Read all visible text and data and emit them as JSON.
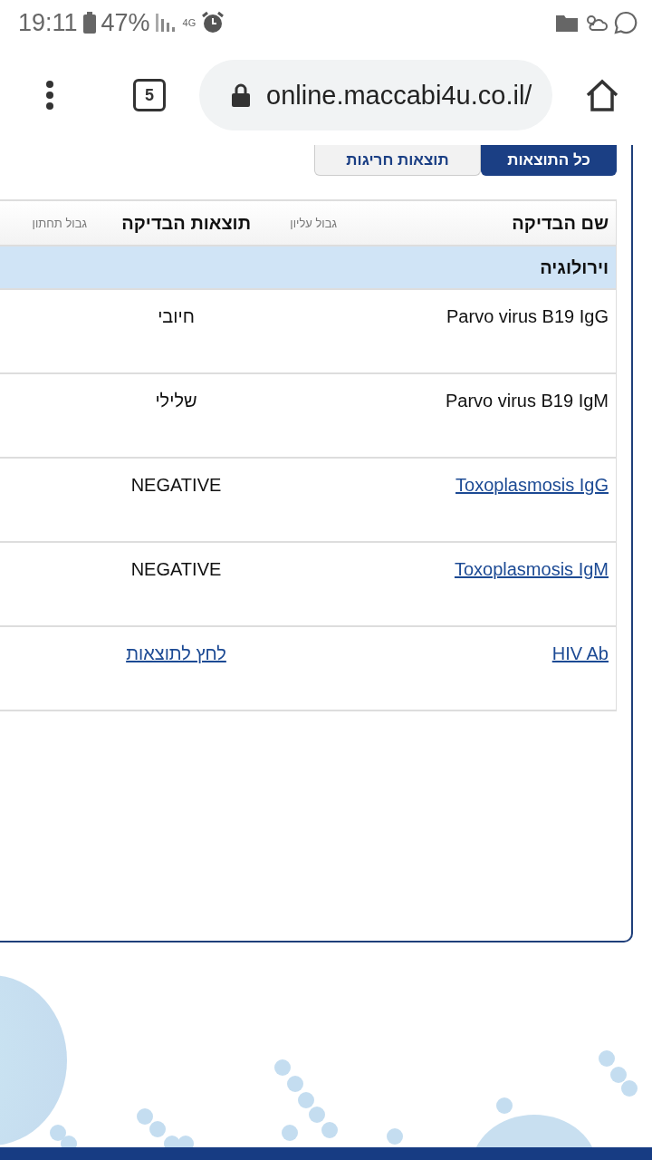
{
  "status_bar": {
    "time": "19:11",
    "battery": "47%",
    "network": "4G"
  },
  "browser": {
    "tab_count": "5",
    "url": "online.maccabi4u.co.il/"
  },
  "tabs": [
    {
      "label": "כל התוצאות",
      "selected": true
    },
    {
      "label": "תוצאות חריגות",
      "selected": false
    }
  ],
  "table": {
    "columns": [
      {
        "label": "שם הבדיקה",
        "kind": "main"
      },
      {
        "label": "גבול עליון",
        "kind": "minor"
      },
      {
        "label": "תוצאות הבדיקה",
        "kind": "main"
      },
      {
        "label": "גבול תחתון",
        "kind": "minor"
      }
    ],
    "group": "וירולוגיה",
    "rows": [
      {
        "name": {
          "text": "Parvo virus B19 IgG",
          "kind": "plain"
        },
        "result": {
          "text": "חיובי",
          "kind": "plain"
        }
      },
      {
        "name": {
          "text": "Parvo virus B19 IgM",
          "kind": "plain"
        },
        "result": {
          "text": "שלילי",
          "kind": "plain"
        }
      },
      {
        "name": {
          "text": "Toxoplasmosis IgG",
          "kind": "link"
        },
        "result": {
          "text": "NEGATIVE",
          "kind": "plain"
        }
      },
      {
        "name": {
          "text": "Toxoplasmosis IgM",
          "kind": "link"
        },
        "result": {
          "text": "NEGATIVE",
          "kind": "plain"
        }
      },
      {
        "name": {
          "text": "HIV Ab",
          "kind": "link"
        },
        "result": {
          "text": "לחץ לתוצאות",
          "kind": "link"
        }
      }
    ]
  }
}
